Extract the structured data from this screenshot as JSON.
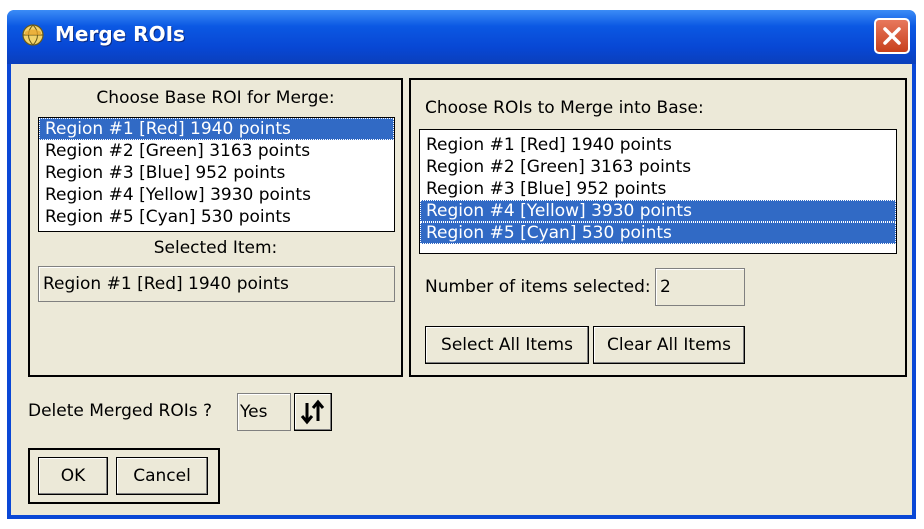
{
  "window": {
    "title": "Merge ROIs",
    "title_icon": "globe-icon",
    "close_icon": "close-x-icon"
  },
  "base_panel": {
    "caption": "Choose Base ROI for Merge:",
    "items": [
      "Region #1 [Red] 1940 points",
      "Region #2 [Green] 3163 points",
      "Region #3 [Blue] 952 points",
      "Region #4 [Yellow] 3930 points",
      "Region #5 [Cyan] 530 points"
    ],
    "selected_index": 0,
    "selected_caption": "Selected Item:",
    "selected_value": "Region #1 [Red] 1940 points"
  },
  "merge_panel": {
    "caption": "Choose ROIs to Merge into Base:",
    "items": [
      "Region #1 [Red] 1940 points",
      "Region #2 [Green] 3163 points",
      "Region #3 [Blue] 952 points",
      "Region #4 [Yellow] 3930 points",
      "Region #5 [Cyan] 530 points"
    ],
    "selected_indices": [
      3,
      4
    ],
    "count_caption": "Number of items selected:",
    "count_value": "2",
    "select_all_label": "Select All Items",
    "clear_all_label": "Clear All Items"
  },
  "delete_option": {
    "caption": "Delete Merged ROIs ?",
    "value": "Yes",
    "toggle_icon": "swap-arrows-icon"
  },
  "actions": {
    "ok_label": "OK",
    "cancel_label": "Cancel"
  },
  "colors": {
    "selection": "#316ac5",
    "dialog_bg": "#ece9d8",
    "title_bar": "#0a47d6",
    "close_button": "#d7512e"
  }
}
